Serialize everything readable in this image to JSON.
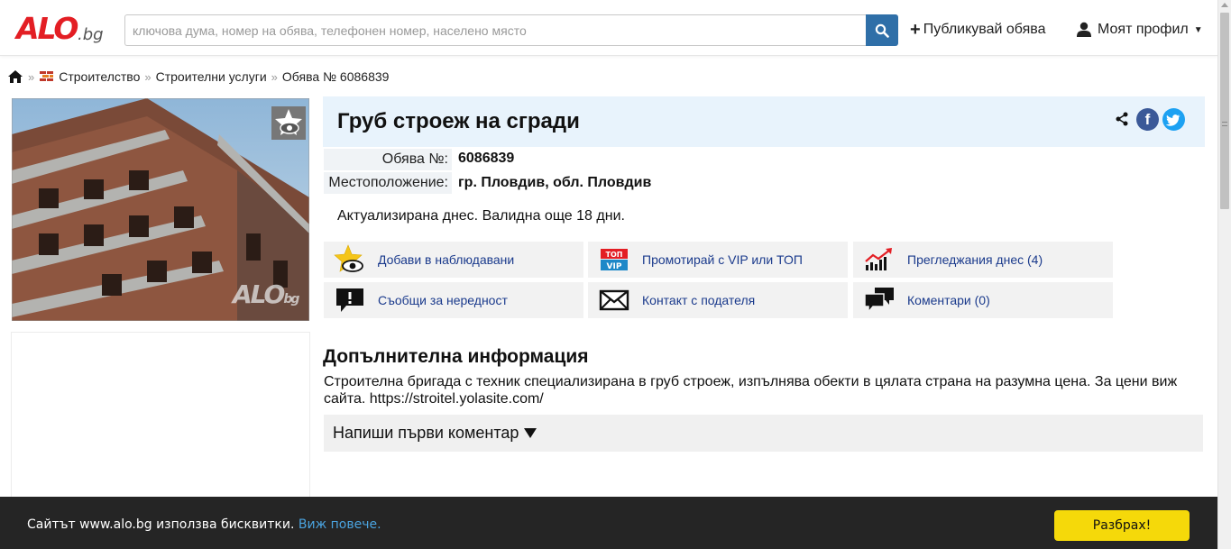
{
  "header": {
    "logo_main": "ALO",
    "logo_suffix": ".bg",
    "search_placeholder": "ключова дума, номер на обява, телефонен номер, населено място",
    "search_value": "",
    "publish_icon": "plus-icon",
    "publish_label": "Публикувай обява",
    "profile_icon": "user-icon",
    "profile_label": "Моят профил"
  },
  "breadcrumb": {
    "items": [
      "Строителство",
      "Строителни услуги",
      "Обява № 6086839"
    ],
    "separator": "»"
  },
  "listing": {
    "title": "Груб строеж на сгради",
    "details": [
      {
        "label": "Обява №:",
        "value": "6086839"
      },
      {
        "label": "Местоположение:",
        "value": "гр. Пловдив, обл. Пловдив"
      }
    ],
    "updated": "Актуализирана днес. Валидна още 18 дни.",
    "photo_watermark_main": "ALO",
    "photo_watermark_suffix": "bg"
  },
  "actions": [
    {
      "icon": "star-eye-icon",
      "label": "Добави в наблюдавани"
    },
    {
      "icon": "top-vip-icon",
      "label": "Промотирай с VIP или ТОП",
      "icon_text_top": "ТОП",
      "icon_text_bottom": "VIP"
    },
    {
      "icon": "chart-icon",
      "label": "Прегледжания днес (4)"
    },
    {
      "icon": "report-icon",
      "label": "Съобщи за нередност"
    },
    {
      "icon": "envelope-icon",
      "label": "Контакт с подателя"
    },
    {
      "icon": "comments-icon",
      "label": "Коментари (0)"
    }
  ],
  "additional_info": {
    "heading": "Допълнителна информация",
    "text": "Строителна бригада с техник специализирана в груб строеж, изпълнява обекти в цялата страна на разумна цена. За цени виж сайта. https://stroitel.yolasite.com/"
  },
  "comments": {
    "prompt": "Напиши първи коментар"
  },
  "cookie": {
    "text": "Сайтът www.alo.bg използва бисквитки.",
    "link": "Виж повече.",
    "button": "Разбрах!"
  },
  "colors": {
    "brand_red": "#e31e24",
    "search_button": "#2f6fa8",
    "title_bg": "#e8f3fc",
    "link": "#1a3a8c",
    "facebook": "#3b5998",
    "twitter": "#1da1f2",
    "cookie_bg": "#252525",
    "cookie_button": "#f5d90a"
  }
}
